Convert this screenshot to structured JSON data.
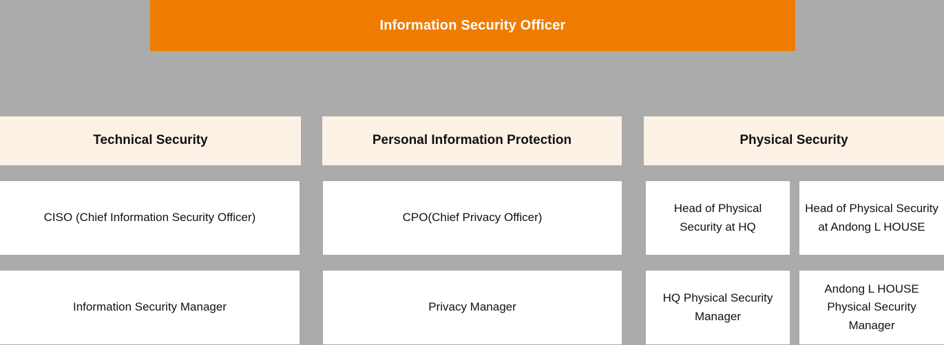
{
  "chart": {
    "type": "org-chart",
    "background_color": "#ababab",
    "root": {
      "label": "Information Security Officer",
      "background_color": "#ef7c00",
      "text_color": "#ffffff"
    },
    "group_header_background": "#fcf1e5",
    "node_background": "#ffffff",
    "columns": [
      {
        "header": "Technical Security",
        "rows": [
          {
            "label": "CISO (Chief Information Security Officer)"
          },
          {
            "label": "Information Security Manager"
          }
        ]
      },
      {
        "header": "Personal Information Protection",
        "rows": [
          {
            "label": "CPO(Chief Privacy Officer)"
          },
          {
            "label": "Privacy Manager"
          }
        ]
      },
      {
        "header": "Physical Security",
        "split_rows": [
          {
            "left": "Head of Physical Security at HQ",
            "right": "Head of Physical Security at Andong L HOUSE"
          },
          {
            "left": "HQ Physical Security Manager",
            "right": "Andong L HOUSE Physical Security Manager"
          }
        ]
      }
    ]
  }
}
